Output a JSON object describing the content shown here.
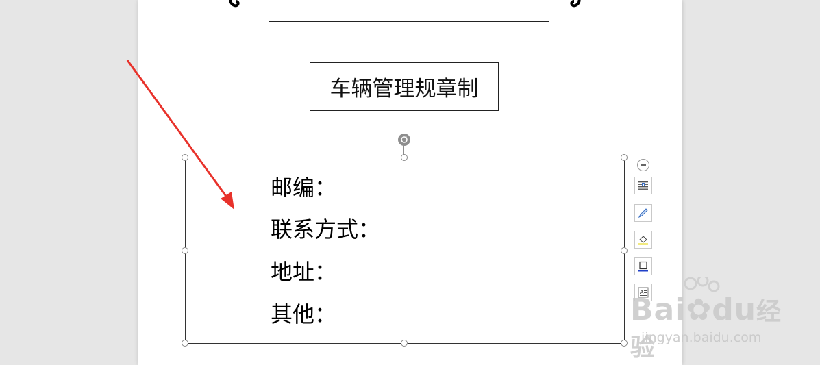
{
  "document": {
    "top_title_glyphs": "",
    "subtitle": "车辆管理规章制",
    "textbox_lines": [
      "邮编：",
      "联系方式：",
      "地址：",
      "其他："
    ]
  },
  "toolbar": {
    "icons": [
      "collapse-icon",
      "text-wrap-icon",
      "pen-icon",
      "fill-icon",
      "border-icon",
      "text-box-icon"
    ]
  },
  "watermark": {
    "brand": "Bai",
    "brand_suffix": "du",
    "jingyan": "经验",
    "url": "jingyan.baidu.com"
  },
  "colors": {
    "annotation_arrow": "#e8322b",
    "page_bg": "#ffffff",
    "canvas_bg": "#e6e6e6"
  }
}
